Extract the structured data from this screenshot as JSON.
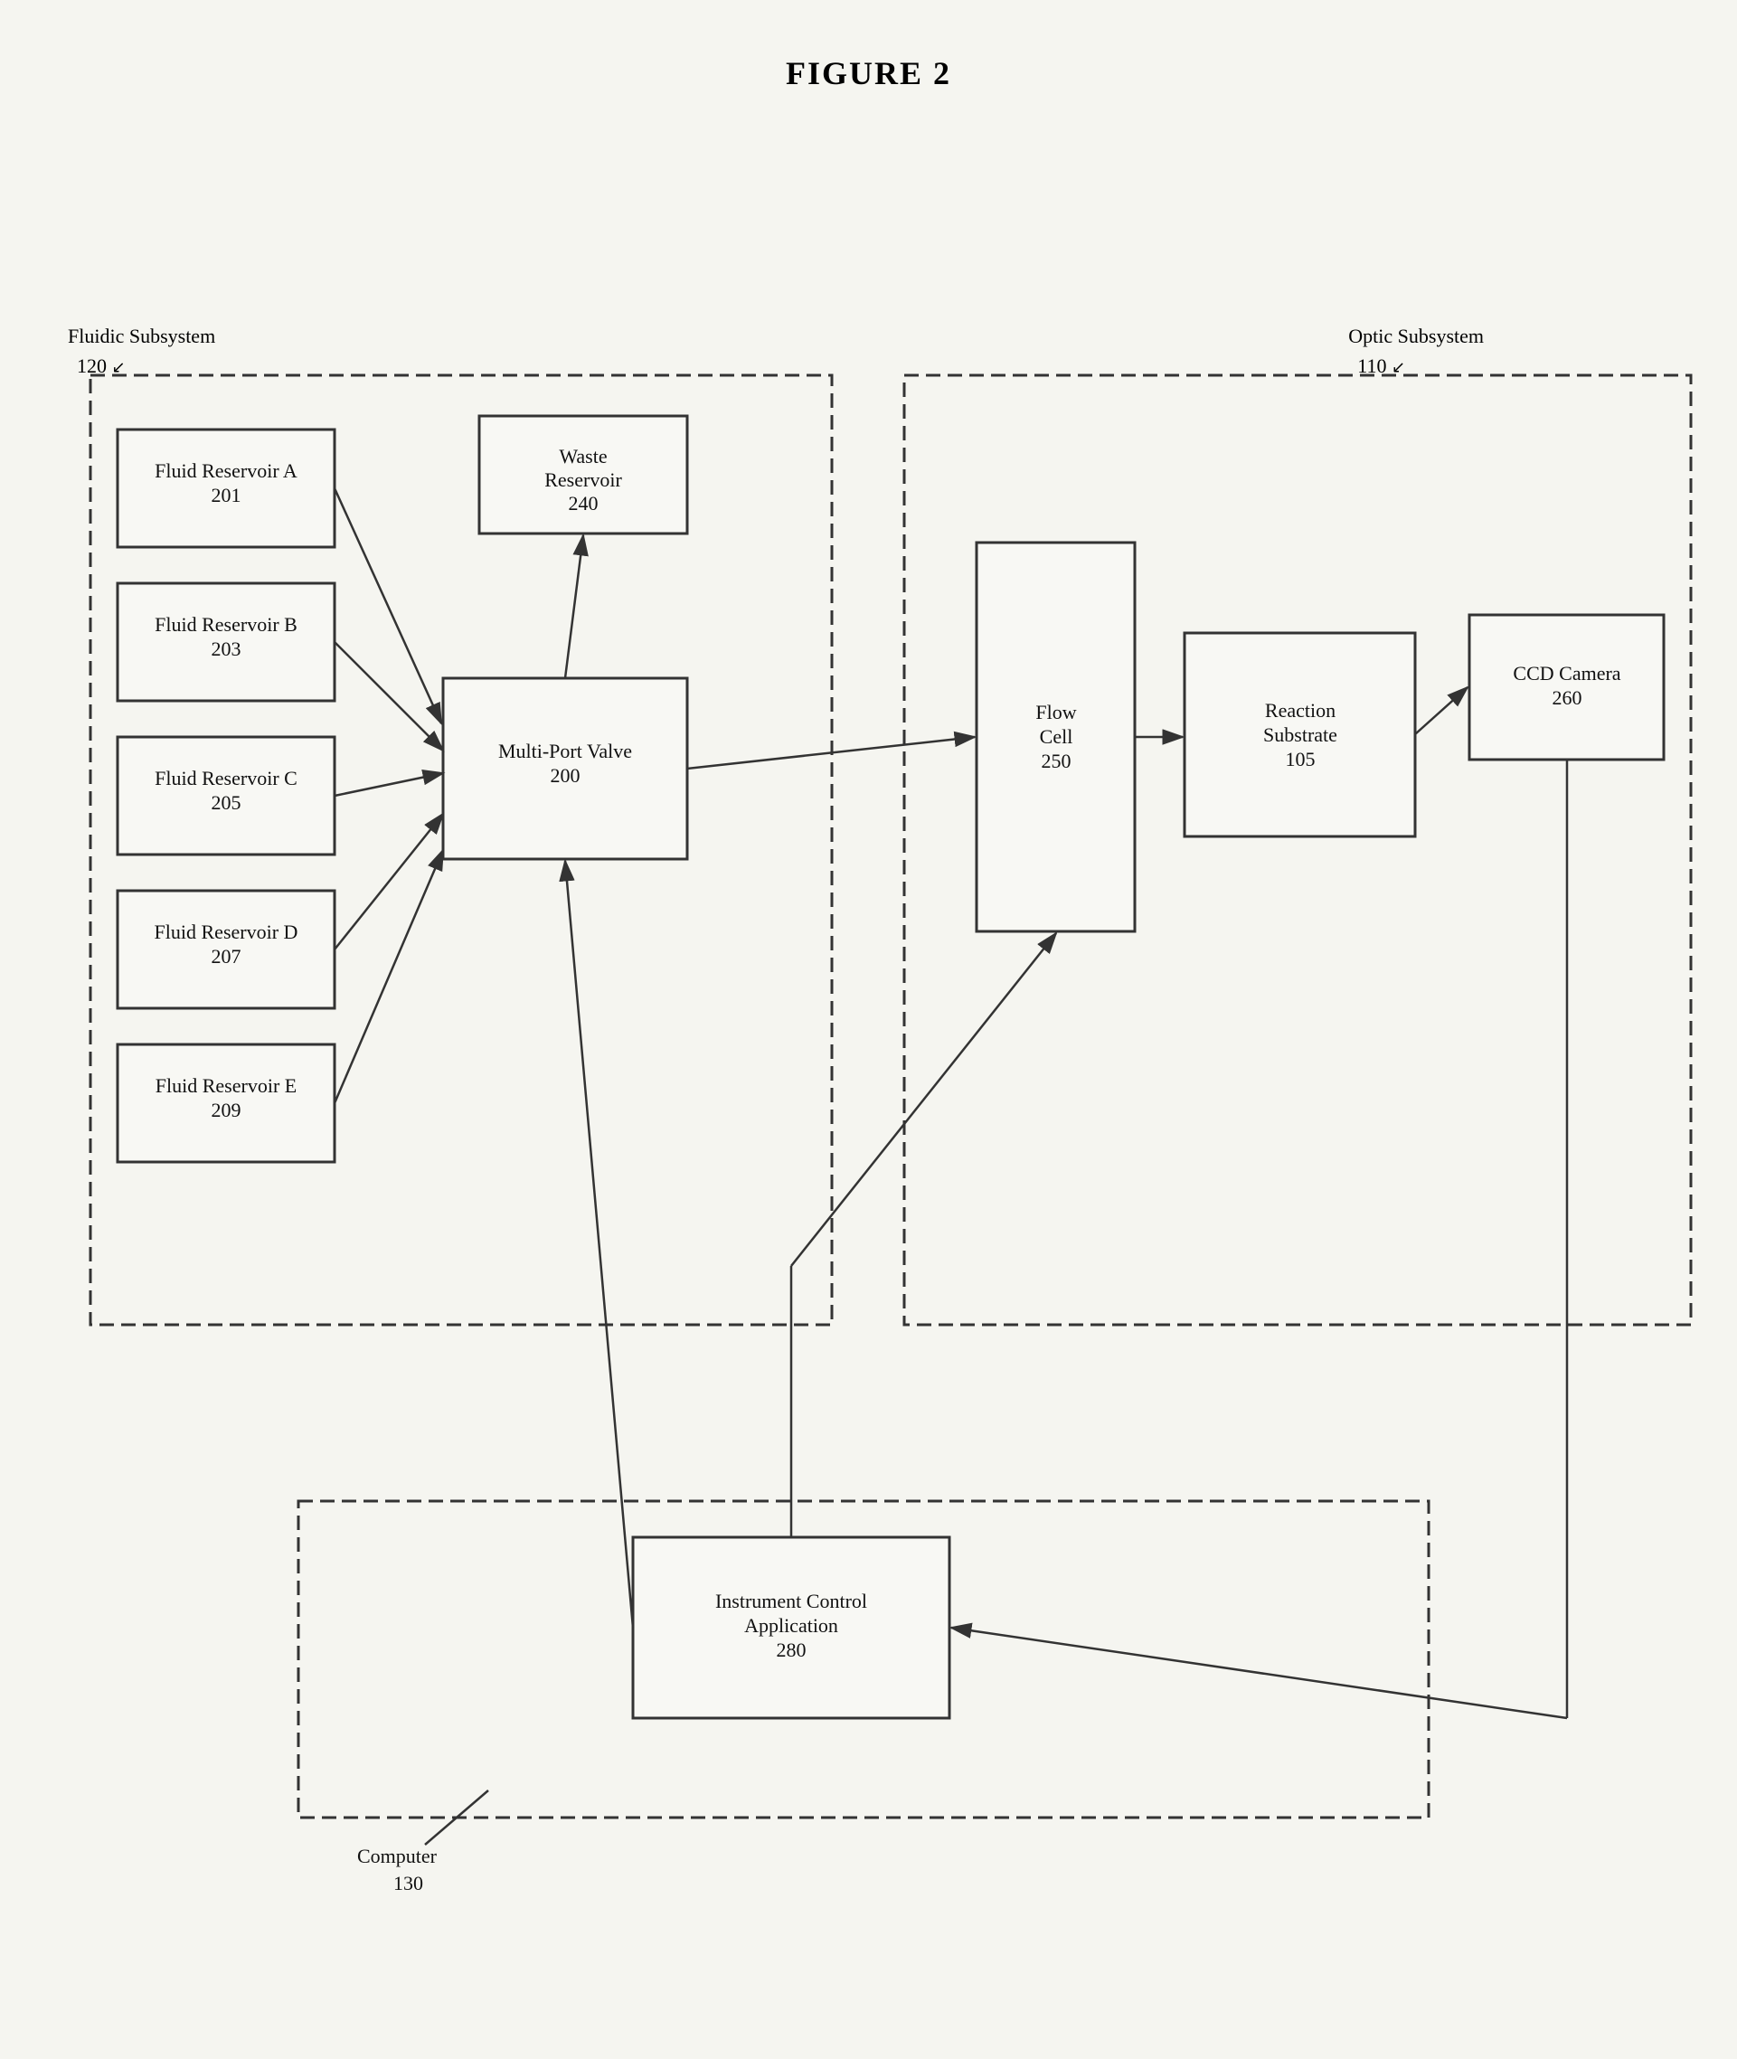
{
  "title": "FIGURE 2",
  "labels": {
    "fluidic_subsystem": "Fluidic Subsystem\n120",
    "fluidic_subsystem_line1": "Fluidic Subsystem",
    "fluidic_subsystem_line2": "120",
    "optic_subsystem": "Optic Subsystem\n110",
    "optic_subsystem_line1": "Optic Subsystem",
    "optic_subsystem_line2": "110",
    "computer": "Computer",
    "computer_num": "130"
  },
  "components": {
    "reservoir_a": {
      "name": "Fluid Reservoir A",
      "number": "201"
    },
    "reservoir_b": {
      "name": "Fluid Reservoir B",
      "number": "203"
    },
    "reservoir_c": {
      "name": "Fluid Reservoir C",
      "number": "205"
    },
    "reservoir_d": {
      "name": "Fluid Reservoir D",
      "number": "207"
    },
    "reservoir_e": {
      "name": "Fluid Reservoir E",
      "number": "209"
    },
    "waste_reservoir": {
      "name": "Waste\nReservoir",
      "number": "240"
    },
    "multi_port_valve": {
      "name": "Multi-Port Valve",
      "number": "200"
    },
    "flow_cell": {
      "name": "Flow\nCell",
      "number": "250"
    },
    "reaction_substrate": {
      "name": "Reaction\nSubstrate",
      "number": "105"
    },
    "ccd_camera": {
      "name": "CCD Camera",
      "number": "260"
    },
    "instrument_control": {
      "name": "Instrument Control\nApplication",
      "number": "280"
    }
  }
}
